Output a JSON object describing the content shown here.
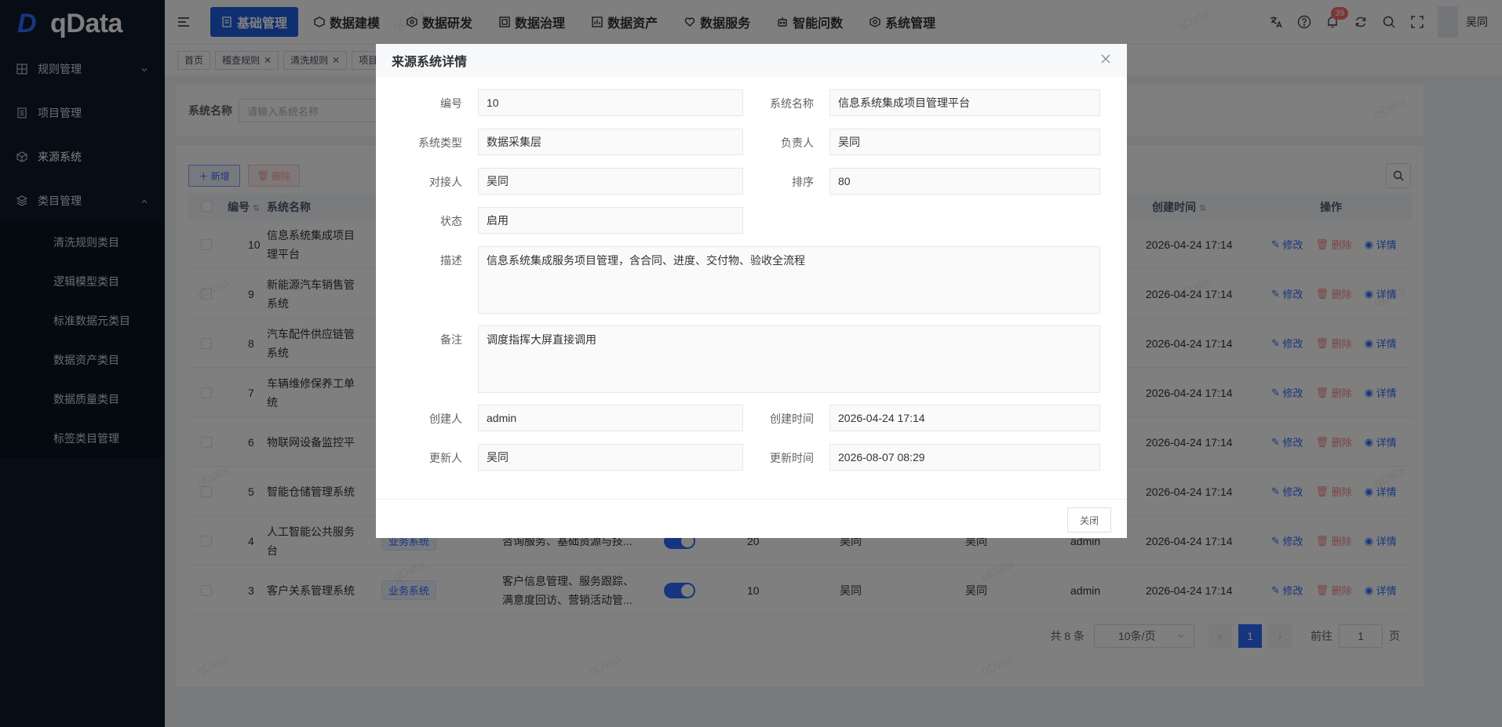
{
  "brand": {
    "logo_text": "qData"
  },
  "sidebar": {
    "items": [
      {
        "label": "规则管理",
        "icon": "grid-icon"
      },
      {
        "label": "项目管理",
        "icon": "doc-icon"
      },
      {
        "label": "来源系统",
        "icon": "cube-icon"
      },
      {
        "label": "类目管理",
        "icon": "layers-icon"
      }
    ],
    "sub_items": [
      "清洗规则类目",
      "逻辑模型类目",
      "标准数据元类目",
      "数据资产类目",
      "数据质量类目",
      "标签类目管理"
    ]
  },
  "header": {
    "nav": [
      "基础管理",
      "数据建模",
      "数据研发",
      "数据治理",
      "数据资产",
      "数据服务",
      "智能问数",
      "系统管理"
    ],
    "badge_count": "39",
    "username": "吴同"
  },
  "tags": [
    "首页",
    "稽查规则",
    "清洗规则",
    "项目"
  ],
  "search": {
    "label": "系统名称",
    "placeholder": "请输入系统名称"
  },
  "toolbar": {
    "add": "新增",
    "delete": "删除"
  },
  "table": {
    "headers": {
      "id": "编号",
      "name": "系统名称",
      "created": "创建时间",
      "ops": "操作"
    },
    "ops": {
      "edit": "修改",
      "delete": "删除",
      "detail": "详情"
    },
    "rows": [
      {
        "id": "10",
        "name1": "信息系统集成项目",
        "name2": "理平台",
        "type": "",
        "desc1": "",
        "desc2": "",
        "sort": "",
        "owner": "",
        "contact": "",
        "creator": "",
        "created": "2026-04-24 17:14"
      },
      {
        "id": "9",
        "name1": "新能源汽车销售管",
        "name2": "系统",
        "type": "",
        "desc1": "",
        "desc2": "",
        "sort": "",
        "owner": "",
        "contact": "",
        "creator": "",
        "created": "2026-04-24 17:14"
      },
      {
        "id": "8",
        "name1": "汽车配件供应链管",
        "name2": "系统",
        "type": "",
        "desc1": "",
        "desc2": "",
        "sort": "",
        "owner": "",
        "contact": "",
        "creator": "",
        "created": "2026-04-24 17:14"
      },
      {
        "id": "7",
        "name1": "车辆维修保养工单",
        "name2": "统",
        "type": "",
        "desc1": "",
        "desc2": "",
        "sort": "",
        "owner": "",
        "contact": "",
        "creator": "",
        "created": "2026-04-24 17:14"
      },
      {
        "id": "6",
        "name1": "物联网设备监控平",
        "name2": "",
        "type": "",
        "desc1": "",
        "desc2": "",
        "sort": "",
        "owner": "",
        "contact": "",
        "creator": "",
        "created": "2026-04-24 17:14"
      },
      {
        "id": "5",
        "name1": "智能仓储管理系统",
        "name2": "",
        "type": "",
        "desc1": "",
        "desc2": "",
        "sort": "",
        "owner": "",
        "contact": "",
        "creator": "",
        "created": "2026-04-24 17:14"
      },
      {
        "id": "4",
        "name1": "人工智能公共服务",
        "name2": "台",
        "type": "业务系统",
        "desc1": "咨询服务、基础资源与技...",
        "desc2": "",
        "sort": "20",
        "owner": "吴同",
        "contact": "吴同",
        "creator": "admin",
        "created": "2026-04-24 17:14"
      },
      {
        "id": "3",
        "name1": "客户关系管理系统",
        "name2": "",
        "type": "业务系统",
        "desc1": "客户信息管理、服务跟踪、",
        "desc2": "满意度回访、营销活动管...",
        "sort": "10",
        "owner": "吴同",
        "contact": "吴同",
        "creator": "admin",
        "created": "2026-04-24 17:14"
      }
    ]
  },
  "pagination": {
    "total": "共 8 条",
    "page_size": "10条/页",
    "current": "1",
    "goto": "前往",
    "goto_value": "1",
    "page_unit": "页"
  },
  "watermark": "qData",
  "modal": {
    "title": "来源系统详情",
    "fields": {
      "id_label": "编号",
      "id_value": "10",
      "name_label": "系统名称",
      "name_value": "信息系统集成项目管理平台",
      "type_label": "系统类型",
      "type_value": "数据采集层",
      "owner_label": "负责人",
      "owner_value": "吴同",
      "contact_label": "对接人",
      "contact_value": "吴同",
      "sort_label": "排序",
      "sort_value": "80",
      "status_label": "状态",
      "status_value": "启用",
      "desc_label": "描述",
      "desc_value": "信息系统集成服务项目管理，含合同、进度、交付物、验收全流程",
      "remark_label": "备注",
      "remark_value": "调度指挥大屏直接调用",
      "creator_label": "创建人",
      "creator_value": "admin",
      "created_label": "创建时间",
      "created_value": "2026-04-24 17:14",
      "updater_label": "更新人",
      "updater_value": "吴同",
      "updated_label": "更新时间",
      "updated_value": "2026-08-07 08:29"
    },
    "close_button": "关闭"
  }
}
